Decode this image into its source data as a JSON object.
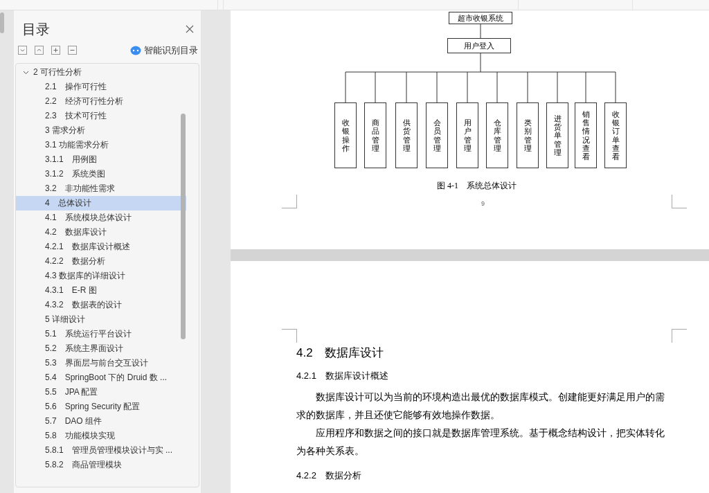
{
  "toc_panel": {
    "title": "目录",
    "smart_button": "智能识别目录",
    "items": [
      {
        "label": "2 可行性分析",
        "expanded": true,
        "selected": false
      },
      {
        "label": "2.1　操作可行性",
        "selected": false
      },
      {
        "label": "2.2　经济可行性分析",
        "selected": false
      },
      {
        "label": "2.3　技术可行性",
        "selected": false
      },
      {
        "label": "3 需求分析",
        "selected": false
      },
      {
        "label": "3.1  功能需求分析",
        "selected": false
      },
      {
        "label": "3.1.1　用例图",
        "selected": false
      },
      {
        "label": "3.1.2　系统类图",
        "selected": false
      },
      {
        "label": "3.2　非功能性需求",
        "selected": false
      },
      {
        "label": "4　总体设计",
        "selected": true
      },
      {
        "label": "4.1　系统模块总体设计",
        "selected": false
      },
      {
        "label": "4.2　数据库设计",
        "selected": false
      },
      {
        "label": "4.2.1　数据库设计概述",
        "selected": false
      },
      {
        "label": "4.2.2　数据分析",
        "selected": false
      },
      {
        "label": "4.3 数据库的详细设计",
        "selected": false
      },
      {
        "label": "4.3.1　E-R 图",
        "selected": false
      },
      {
        "label": "4.3.2　数据表的设计",
        "selected": false
      },
      {
        "label": "5  详细设计",
        "selected": false
      },
      {
        "label": "5.1　系统运行平台设计",
        "selected": false
      },
      {
        "label": "5.2　系统主界面设计",
        "selected": false
      },
      {
        "label": "5.3　界面层与前台交互设计",
        "selected": false
      },
      {
        "label": "5.4　SpringBoot 下的 Druid 数 ...",
        "selected": false
      },
      {
        "label": "5.5　JPA 配置",
        "selected": false
      },
      {
        "label": "5.6　Spring Security 配置",
        "selected": false
      },
      {
        "label": "5.7　DAO 组件",
        "selected": false
      },
      {
        "label": "5.8　功能模块实现",
        "selected": false
      },
      {
        "label": "5.8.1　管理员管理模块设计与实 ...",
        "selected": false
      },
      {
        "label": "5.8.2　商品管理模块",
        "selected": false
      }
    ]
  },
  "document": {
    "diagram": {
      "root": "超市收银系统",
      "login": "用户登入",
      "modules": [
        "收银操作",
        "商品管理",
        "供货管理",
        "会员管理",
        "用户管理",
        "仓库管理",
        "类别管理",
        "进货单管理",
        "销售情况查看",
        "收银订单查看"
      ]
    },
    "figure_caption": "图 4-1　系统总体设计",
    "page_number": "9",
    "section_heading": "4.2　数据库设计",
    "subheading_1": "4.2.1　数据库设计概述",
    "paragraphs": [
      "数据库设计可以为当前的环境构造出最优的数据库模式。创建能更好满足用户的需求的数据库，并且还使它能够有效地操作数据。",
      "应用程序和数据之间的接口就是数据库管理系统。基于概念结构设计，把实体转化为各种关系表。"
    ],
    "subheading_2": "4.2.2　数据分析"
  }
}
